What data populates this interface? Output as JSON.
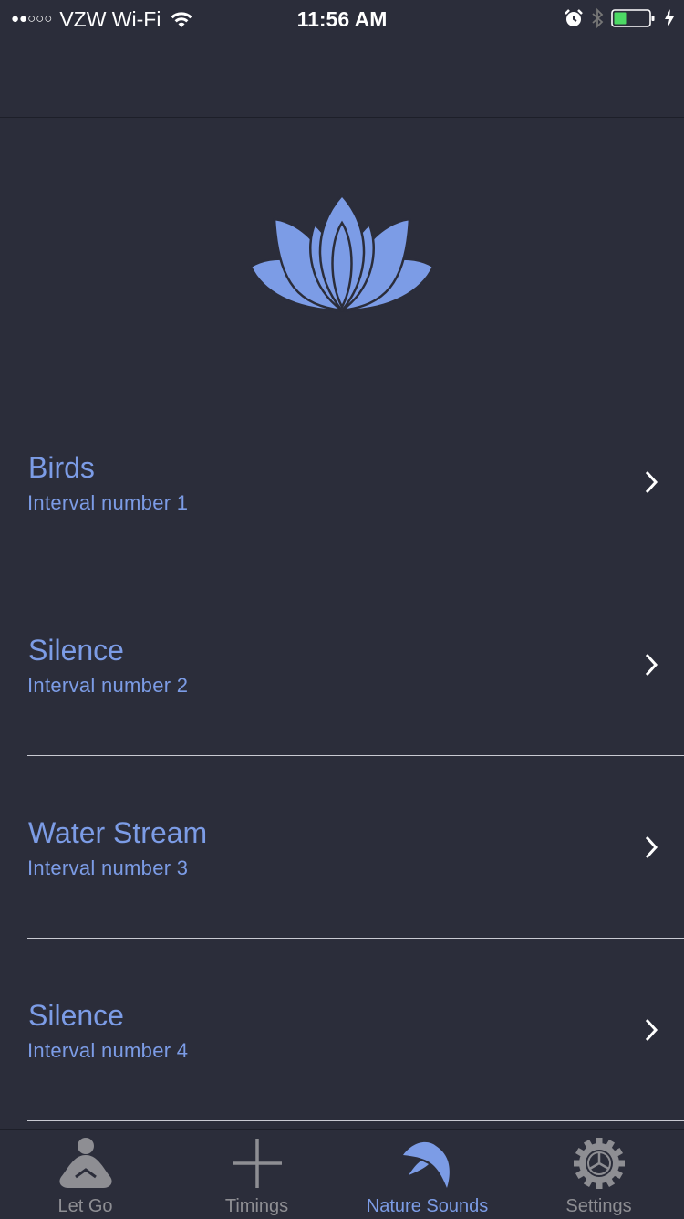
{
  "status_bar": {
    "signal": "●●○○○",
    "carrier": "VZW Wi-Fi",
    "time": "11:56 AM"
  },
  "colors": {
    "background": "#2b2d3a",
    "accent": "#7c9ce6",
    "tab_inactive": "#8e8e93",
    "separator": "#c9cad2",
    "battery_fill": "#4cd964"
  },
  "logo": {
    "icon": "lotus-icon"
  },
  "intervals": [
    {
      "title": "Birds",
      "subtitle": "Interval number 1"
    },
    {
      "title": "Silence",
      "subtitle": "Interval number 2"
    },
    {
      "title": "Water Stream",
      "subtitle": "Interval number 3"
    },
    {
      "title": "Silence",
      "subtitle": "Interval number 4"
    }
  ],
  "tabs": [
    {
      "label": "Let Go",
      "icon": "meditation-icon"
    },
    {
      "label": "Timings",
      "icon": "plus-icon"
    },
    {
      "label": "Nature Sounds",
      "icon": "bird-icon",
      "active": true
    },
    {
      "label": "Settings",
      "icon": "gear-icon"
    }
  ]
}
